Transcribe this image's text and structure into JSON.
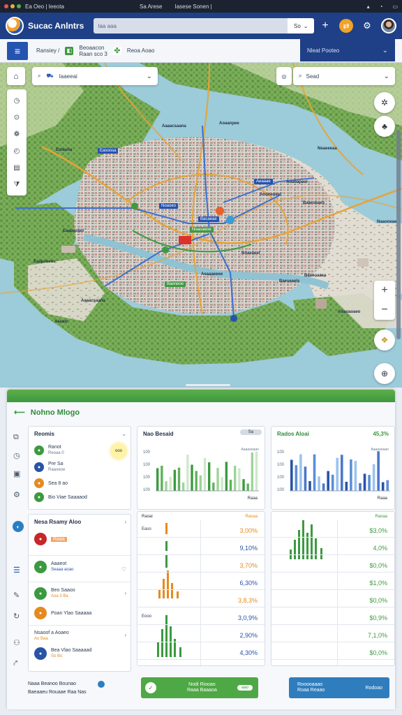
{
  "os": {
    "title": "Ea Oeo | Ieeota",
    "mid1": "Sa Arese",
    "mid2": "Iasese Sonen |",
    "icons": [
      "signal-icon",
      "wifi-icon",
      "battery-icon"
    ]
  },
  "header": {
    "title": "Sucac Anlntrs",
    "search_placeholder": "Iaa aaa",
    "select_value": "So",
    "colors": {
      "bar": "#1f3f86",
      "accent": "#f0a32a"
    }
  },
  "nav": {
    "crumb1": "Ransiey /",
    "crumb2_line1": "Beoaacon",
    "crumb2_line2": "Raan sco 3",
    "crumb3": "Reoa Aoao",
    "right_label": "Nleat Pooteo"
  },
  "map": {
    "control_left_label": "Iaaeeai",
    "control_right_label": "Sead",
    "city_labels": [
      "Aaaacsaana",
      "Aoaanpee",
      "Emauna",
      "Neaeeeaa",
      "Baaeseaes",
      "Aoooeoeal",
      "Eaapaoaol",
      "Eaapoeeau",
      "Aeaaaeeee",
      "Baeseaels",
      "Aaaacsaana",
      "Aasalc",
      "Beaeoaaea",
      "Naaooeae",
      "Aoaoaoaeo",
      "Aoaoapaol",
      "Boaeaeel"
    ],
    "chip_labels": [
      "Easoosa",
      "Aeaaae",
      "Noaoeo",
      "Bacaeae",
      "Noaoaeoe",
      "Baeneoe"
    ],
    "zoom_in": "+",
    "zoom_out": "−"
  },
  "dashboard": {
    "title": "Nohno Mlogo",
    "routes": {
      "title": "Reomis",
      "items": [
        {
          "label": "Ranot",
          "sub": "Reoaa 0",
          "color": "#3b9a3f"
        },
        {
          "label": "Pre Sa",
          "sub": "Raaoeoe",
          "color": "#2953a6"
        },
        {
          "label": "Sea 8 ao",
          "sub": "",
          "color": "#e58a1f"
        },
        {
          "label": "Bio Viae Saaaaod",
          "sub": "",
          "color": "#3b9a3f"
        }
      ],
      "badge": "ooo"
    },
    "list": {
      "title": "Nesa Rsamy Aloo",
      "items": [
        {
          "label": "Raaa",
          "sub": "",
          "color": "#c62828"
        },
        {
          "label": "Aaaeot",
          "sub": "Seaaa aoao",
          "color": "#3b9a3f"
        },
        {
          "label": "Beo Saaoo",
          "sub": "Aoa 3 Ba",
          "color": "#3b9a3f"
        },
        {
          "label": "Poan Ylao Saaaaa",
          "sub": "",
          "color": "#e58a1f"
        },
        {
          "label": "Nsaoof a Aoaeo",
          "sub": "Ao Baa",
          "color": "#2953a6"
        },
        {
          "label": "Bea Vlao Saaaaad",
          "sub": "So Bo",
          "color": "#2953a6"
        }
      ],
      "footer_title": "Naaa Beanoo Bounao",
      "footer_sub": "Baeaaeu Rouaae   Raa Nas"
    },
    "chart_left": {
      "title": "Nao Besaid",
      "pill": "Sa",
      "axis_label": "Aaaaoeaan",
      "yticks": [
        "100",
        "100",
        "100",
        "100"
      ],
      "xlabel": "Raaa"
    },
    "chart_right": {
      "title": "Rados Aloai",
      "value": "45,3%",
      "axis_label": "Aaaaoeaan",
      "yticks": [
        "100",
        "100",
        "100",
        "100"
      ],
      "xlabel": "Raaa"
    },
    "table_left": {
      "head_left": "Raoai",
      "head_right": "Raoaa",
      "rows": [
        {
          "label": "Easo",
          "value": "3,00%",
          "cls": "orange"
        },
        {
          "label": "",
          "value": "9,10%",
          "cls": "blue"
        },
        {
          "label": "",
          "value": "3,70%",
          "cls": "orange"
        },
        {
          "label": "",
          "value": "6,30%",
          "cls": "blue"
        },
        {
          "label": "",
          "value": "3,8,3%",
          "cls": "orange"
        },
        {
          "label": "Eooo",
          "value": "3,0,9%",
          "cls": "blue"
        },
        {
          "label": "",
          "value": "2,90%",
          "cls": "blue"
        },
        {
          "label": "",
          "value": "4,30%",
          "cls": "blue"
        }
      ]
    },
    "table_right": {
      "head_right": "Raoaa",
      "rows": [
        {
          "label": "",
          "value": "$3,0%",
          "cls": "green"
        },
        {
          "label": "",
          "value": "4,0%",
          "cls": "green"
        },
        {
          "label": "",
          "value": "$0,0%",
          "cls": "green"
        },
        {
          "label": "",
          "value": "$1,0%",
          "cls": "green"
        },
        {
          "label": "",
          "value": "$0,0%",
          "cls": "green"
        },
        {
          "label": "",
          "value": "$0,9%",
          "cls": "green"
        },
        {
          "label": "",
          "value": "7,1,0%",
          "cls": "green"
        },
        {
          "label": "",
          "value": "$0,0%",
          "cls": "green"
        }
      ]
    },
    "btn_left": {
      "line1": "Nodi Riooao",
      "line2": "Raaa Baaaoa",
      "pill": "aao"
    },
    "btn_right": {
      "line1": "Rooooaaao",
      "line2": "Roaa Reaao",
      "right": "Rodoao"
    }
  }
}
